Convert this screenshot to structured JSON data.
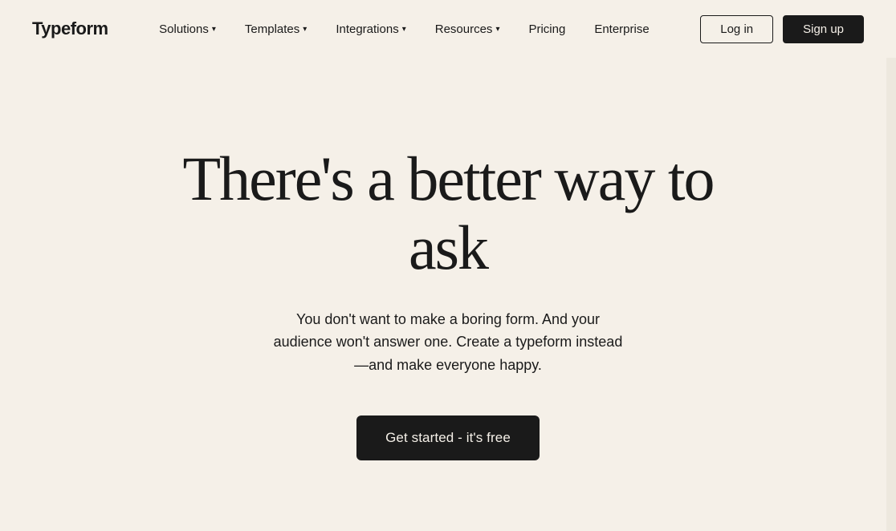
{
  "brand": {
    "logo": "Typeform"
  },
  "nav": {
    "links": [
      {
        "label": "Solutions",
        "hasDropdown": true
      },
      {
        "label": "Templates",
        "hasDropdown": true
      },
      {
        "label": "Integrations",
        "hasDropdown": true
      },
      {
        "label": "Resources",
        "hasDropdown": true
      },
      {
        "label": "Pricing",
        "hasDropdown": false
      },
      {
        "label": "Enterprise",
        "hasDropdown": false
      }
    ],
    "login_label": "Log in",
    "signup_label": "Sign up"
  },
  "hero": {
    "title": "There's a better way to ask",
    "subtitle": "You don't want to make a boring form. And your audience won't answer one. Create a typeform instead—and make everyone happy.",
    "cta_label": "Get started - it's free"
  }
}
